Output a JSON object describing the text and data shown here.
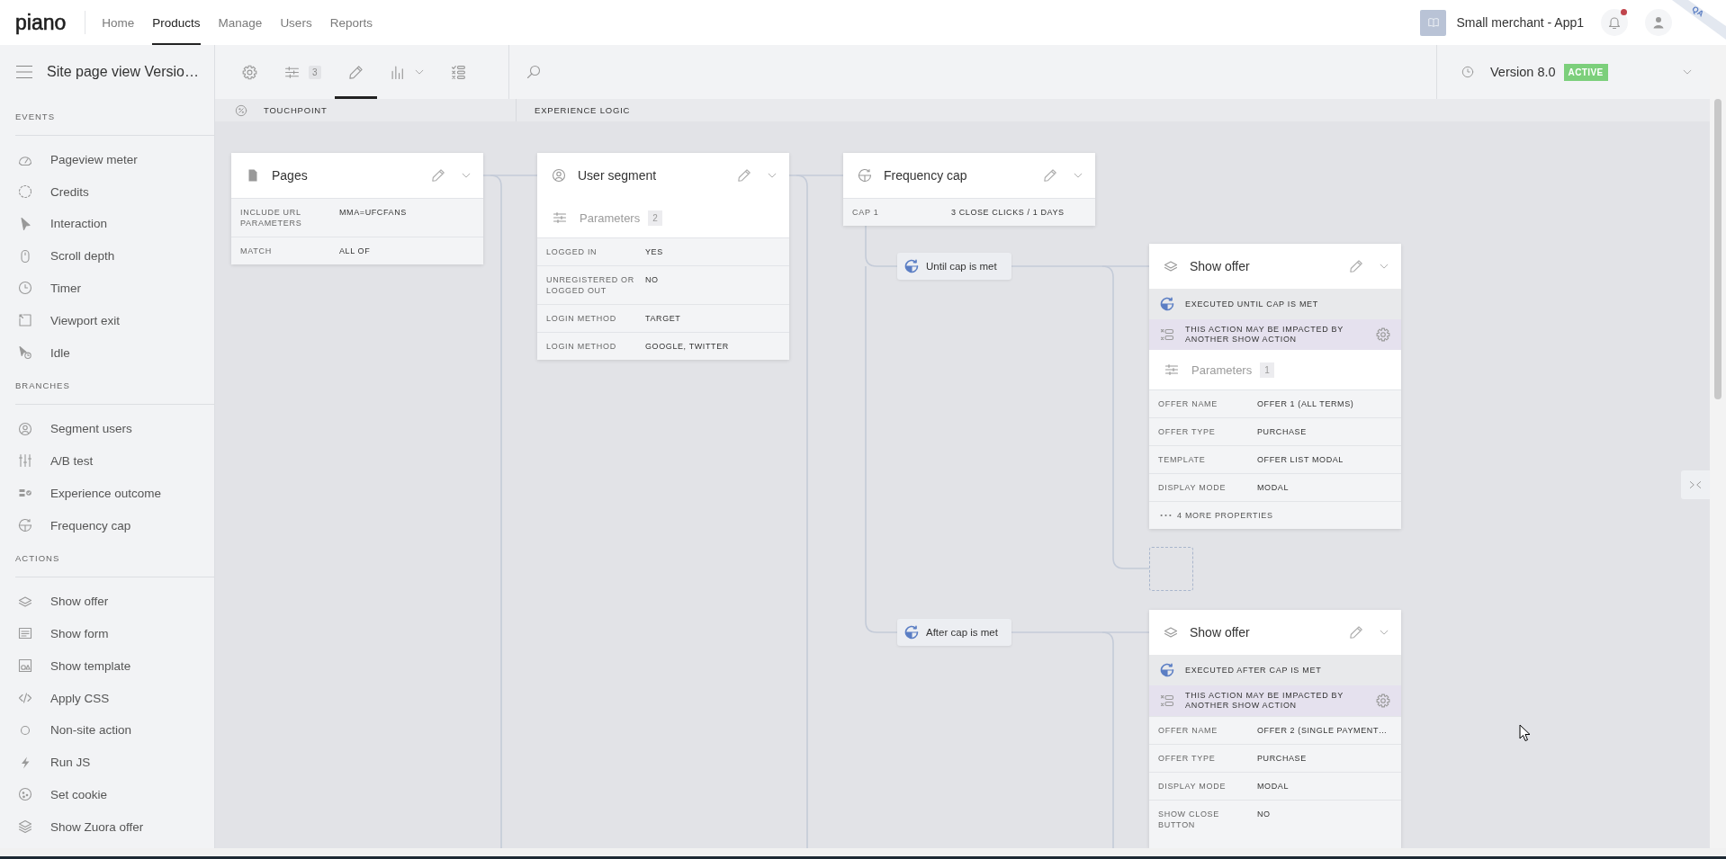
{
  "top_nav": {
    "logo": "piano",
    "items": [
      {
        "label": "Home",
        "selected": false
      },
      {
        "label": "Products",
        "selected": true
      },
      {
        "label": "Manage",
        "selected": false
      },
      {
        "label": "Users",
        "selected": false
      },
      {
        "label": "Reports",
        "selected": false
      }
    ],
    "account": "Small merchant - App1",
    "notifications": {
      "unread": true
    },
    "ribbon": "QA"
  },
  "toolbar": {
    "title": "Site page view Versio…",
    "tools": [
      {
        "selected": false,
        "dropdown": false
      },
      {
        "badge": "3",
        "selected": false,
        "dropdown": false
      },
      {
        "selected": true,
        "dropdown": false
      },
      {
        "selected": false,
        "dropdown": true
      },
      {
        "selected": false,
        "dropdown": false
      }
    ],
    "version": {
      "label": "Version 8.0",
      "status": "ACTIVE"
    }
  },
  "column_headers": [
    "TOUCHPOINT",
    "EXPERIENCE LOGIC"
  ],
  "sidebar": {
    "sections": [
      {
        "title": "EVENTS",
        "items": [
          "Pageview meter",
          "Credits",
          "Interaction",
          "Scroll depth",
          "Timer",
          "Viewport exit",
          "Idle"
        ]
      },
      {
        "title": "BRANCHES",
        "items": [
          "Segment users",
          "A/B test",
          "Experience outcome",
          "Frequency cap"
        ]
      },
      {
        "title": "ACTIONS",
        "items": [
          "Show offer",
          "Show form",
          "Show template",
          "Apply CSS",
          "Non-site action",
          "Run JS",
          "Set cookie",
          "Show Zuora offer"
        ]
      }
    ]
  },
  "canvas": {
    "nodes": [
      {
        "kind": "pages",
        "title": "Pages",
        "rows": [
          {
            "label": "INCLUDE URL PARAMETERS",
            "value": "MMA=UFCFANS"
          },
          {
            "label": "MATCH",
            "value": "ALL OF"
          }
        ]
      },
      {
        "kind": "segment",
        "title": "User segment",
        "parameters": {
          "label": "Parameters",
          "count": "2"
        },
        "rows": [
          {
            "label": "LOGGED IN",
            "value": "YES"
          },
          {
            "label": "UNREGISTERED OR LOGGED OUT",
            "value": "NO"
          },
          {
            "label": "LOGIN METHOD",
            "value": "TARGET"
          },
          {
            "label": "LOGIN METHOD",
            "value": "GOOGLE, TWITTER"
          }
        ]
      },
      {
        "kind": "frequency_cap",
        "title": "Frequency cap",
        "rows": [
          {
            "label": "CAP 1",
            "value": "3 CLOSE CLICKS / 1 DAYS"
          }
        ]
      },
      {
        "kind": "show_offer",
        "title": "Show offer",
        "status": "EXECUTED UNTIL CAP IS MET",
        "notice": "THIS ACTION MAY BE IMPACTED BY ANOTHER SHOW ACTION",
        "parameters": {
          "label": "Parameters",
          "count": "1"
        },
        "rows": [
          {
            "label": "OFFER NAME",
            "value": "OFFER 1 (ALL TERMS)"
          },
          {
            "label": "OFFER TYPE",
            "value": "PURCHASE"
          },
          {
            "label": "TEMPLATE",
            "value": "OFFER LIST MODAL"
          },
          {
            "label": "DISPLAY MODE",
            "value": "MODAL"
          }
        ],
        "more": "4 MORE PROPERTIES"
      },
      {
        "kind": "show_offer",
        "title": "Show offer",
        "status": "EXECUTED AFTER CAP IS MET",
        "notice": "THIS ACTION MAY BE IMPACTED BY ANOTHER SHOW ACTION",
        "rows": [
          {
            "label": "OFFER NAME",
            "value": "OFFER 2 (SINGLE PAYMENT…"
          },
          {
            "label": "OFFER TYPE",
            "value": "PURCHASE"
          },
          {
            "label": "DISPLAY MODE",
            "value": "MODAL"
          },
          {
            "label": "SHOW CLOSE BUTTON",
            "value": "NO"
          }
        ]
      }
    ],
    "branches": [
      {
        "label": "Until cap is met"
      },
      {
        "label": "After cap is met"
      }
    ]
  }
}
